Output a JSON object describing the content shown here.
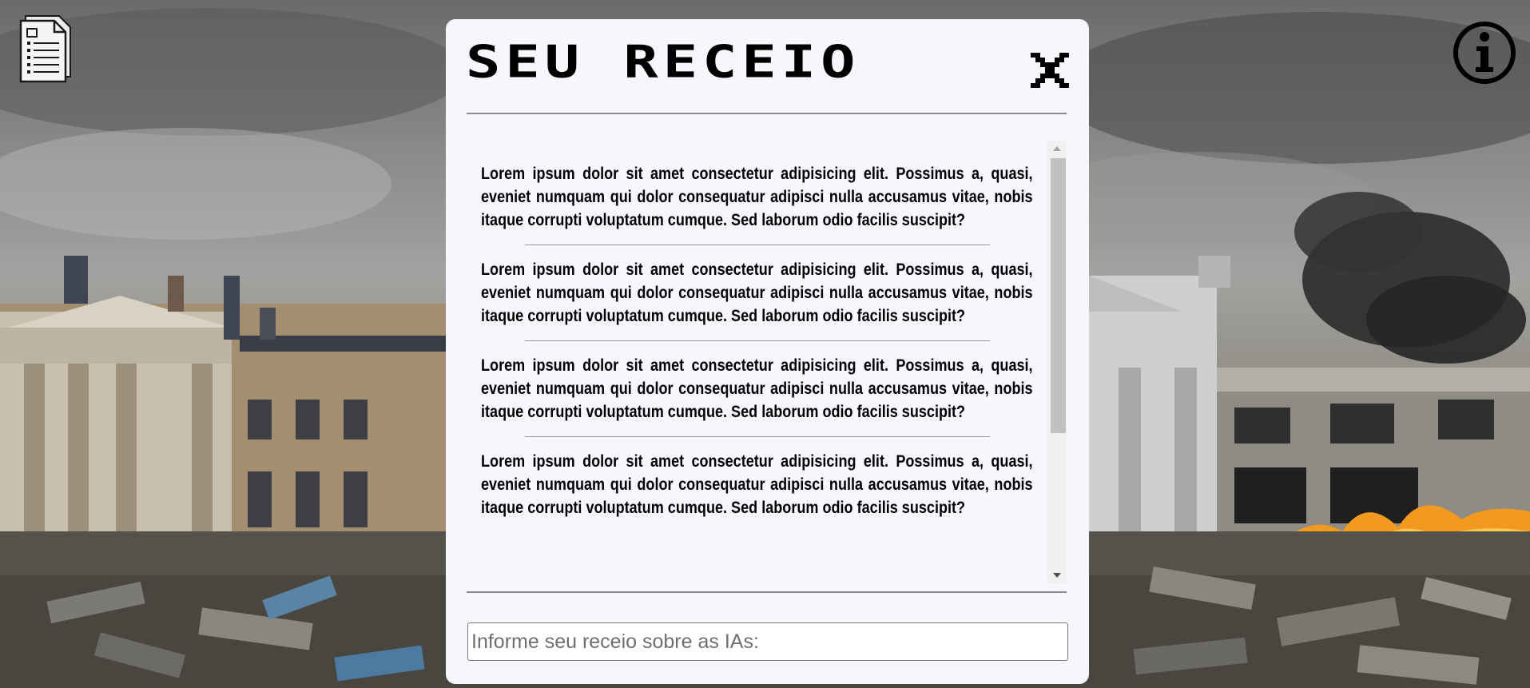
{
  "modal": {
    "title": "SEU RECEIO",
    "close_icon": "close-icon"
  },
  "messages": [
    "Lorem ipsum dolor sit amet consectetur adipisicing elit. Possimus a, quasi, eveniet numquam qui dolor consequatur adipisci nulla accusamus vitae, nobis itaque corrupti voluptatum cumque. Sed laborum odio facilis suscipit?",
    "Lorem ipsum dolor sit amet consectetur adipisicing elit. Possimus a, quasi, eveniet numquam qui dolor consequatur adipisci nulla accusamus vitae, nobis itaque corrupti voluptatum cumque. Sed laborum odio facilis suscipit?",
    "Lorem ipsum dolor sit amet consectetur adipisicing elit. Possimus a, quasi, eveniet numquam qui dolor consequatur adipisci nulla accusamus vitae, nobis itaque corrupti voluptatum cumque. Sed laborum odio facilis suscipit?",
    "Lorem ipsum dolor sit amet consectetur adipisicing elit. Possimus a, quasi, eveniet numquam qui dolor consequatur adipisci nulla accusamus vitae, nobis itaque corrupti voluptatum cumque. Sed laborum odio facilis suscipit?"
  ],
  "input": {
    "placeholder": "Informe seu receio sobre as IAs:",
    "value": ""
  },
  "icons": {
    "top_left": "document-icon",
    "top_right": "info-icon"
  },
  "colors": {
    "modal_background": "#f6f7fd",
    "text": "#000000",
    "divider": "#8c8c8c",
    "fire": "#f29a1f"
  }
}
